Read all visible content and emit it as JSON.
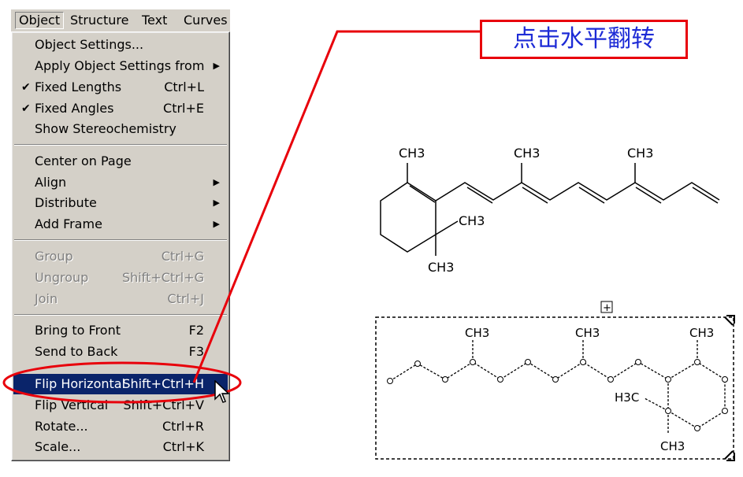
{
  "menubar": {
    "items": [
      {
        "label": "Object"
      },
      {
        "label": "Structure"
      },
      {
        "label": "Text"
      },
      {
        "label": "Curves"
      }
    ]
  },
  "menu": {
    "items": [
      {
        "label": "Object Settings...",
        "shortcut": "",
        "check": "",
        "arrow": "",
        "disabled": false
      },
      {
        "label": "Apply Object Settings from",
        "shortcut": "",
        "check": "",
        "arrow": "▶",
        "disabled": false
      },
      {
        "label": "Fixed Lengths",
        "shortcut": "Ctrl+L",
        "check": "✔",
        "arrow": "",
        "disabled": false
      },
      {
        "label": "Fixed Angles",
        "shortcut": "Ctrl+E",
        "check": "✔",
        "arrow": "",
        "disabled": false
      },
      {
        "label": "Show Stereochemistry",
        "shortcut": "",
        "check": "",
        "arrow": "",
        "disabled": false
      },
      {
        "label": "Center on Page",
        "shortcut": "",
        "check": "",
        "arrow": "",
        "disabled": false
      },
      {
        "label": "Align",
        "shortcut": "",
        "check": "",
        "arrow": "▶",
        "disabled": false
      },
      {
        "label": "Distribute",
        "shortcut": "",
        "check": "",
        "arrow": "▶",
        "disabled": false
      },
      {
        "label": "Add Frame",
        "shortcut": "",
        "check": "",
        "arrow": "▶",
        "disabled": false
      },
      {
        "label": "Group",
        "shortcut": "Ctrl+G",
        "check": "",
        "arrow": "",
        "disabled": true
      },
      {
        "label": "Ungroup",
        "shortcut": "Shift+Ctrl+G",
        "check": "",
        "arrow": "",
        "disabled": true
      },
      {
        "label": "Join",
        "shortcut": "Ctrl+J",
        "check": "",
        "arrow": "",
        "disabled": true
      },
      {
        "label": "Bring to Front",
        "shortcut": "F2",
        "check": "",
        "arrow": "",
        "disabled": false
      },
      {
        "label": "Send to Back",
        "shortcut": "F3",
        "check": "",
        "arrow": "",
        "disabled": false
      },
      {
        "label": "Flip Horizontal",
        "shortcut": "Shift+Ctrl+H",
        "check": "",
        "arrow": "",
        "disabled": false,
        "selected": true
      },
      {
        "label": "Flip Vertical",
        "shortcut": "Shift+Ctrl+V",
        "check": "",
        "arrow": "",
        "disabled": false
      },
      {
        "label": "Rotate...",
        "shortcut": "Ctrl+R",
        "check": "",
        "arrow": "",
        "disabled": false
      },
      {
        "label": "Scale...",
        "shortcut": "Ctrl+K",
        "check": "",
        "arrow": "",
        "disabled": false
      }
    ]
  },
  "callout": {
    "text": "点击水平翻转"
  },
  "molecule_top": {
    "labels": [
      "CH3",
      "CH3",
      "CH3",
      "CH3",
      "CH3"
    ]
  },
  "molecule_selected": {
    "labels": [
      "CH3",
      "CH3",
      "CH3",
      "H3C",
      "CH3"
    ]
  },
  "colors": {
    "highlight": "#0a246a",
    "annotation": "#e8000b",
    "callout_text": "#1d2bd6",
    "menu_bg": "#d4d0c8"
  },
  "icons": {
    "check": "check-icon",
    "submenu": "submenu-arrow-icon",
    "cursor": "arrow-cursor-icon",
    "frame_handle": "frame-handle-icon"
  }
}
